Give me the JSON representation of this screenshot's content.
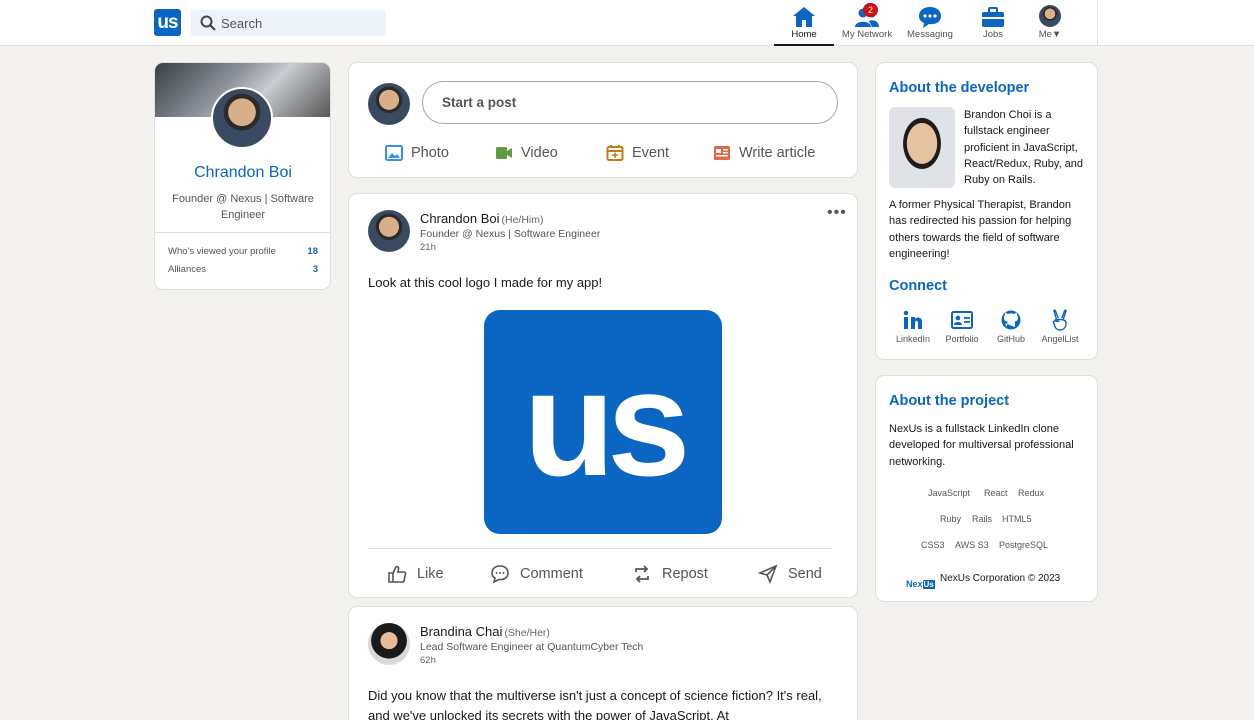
{
  "nav": {
    "logo_text": "us",
    "search_placeholder": "Search",
    "items": [
      {
        "label": "Home",
        "icon": "home-icon"
      },
      {
        "label": "My Network",
        "icon": "network-icon",
        "badge": "2"
      },
      {
        "label": "Messaging",
        "icon": "messaging-icon"
      },
      {
        "label": "Jobs",
        "icon": "jobs-icon"
      },
      {
        "label": "Me▼",
        "icon": "me-avatar"
      }
    ]
  },
  "profile": {
    "name": "Chrandon Boi",
    "headline": "Founder @ Nexus | Software Engineer",
    "stats": [
      {
        "label": "Who's viewed your profile",
        "value": "18"
      },
      {
        "label": "Alliances",
        "value": "3"
      }
    ]
  },
  "composer": {
    "placeholder": "Start a post",
    "actions": [
      {
        "label": "Photo",
        "color": "#378fe9"
      },
      {
        "label": "Video",
        "color": "#5f9b41"
      },
      {
        "label": "Event",
        "color": "#c37d16"
      },
      {
        "label": "Write article",
        "color": "#e06847"
      }
    ]
  },
  "posts": [
    {
      "author": "Chrandon Boi",
      "pronouns": "(He/Him)",
      "headline": "Founder @ Nexus | Software Engineer",
      "time": "21h",
      "text": "Look at this cool logo I made for my app!",
      "image_text": "us",
      "actions": [
        "Like",
        "Comment",
        "Repost",
        "Send"
      ]
    },
    {
      "author": "Brandina Chai",
      "pronouns": "(She/Her)",
      "headline": "Lead Software Engineer at QuantumCyber Tech",
      "time": "62h",
      "text": "Did you know that the multiverse isn't just a concept of science fiction? It's real, and we've unlocked its secrets with the power of JavaScript. At"
    }
  ],
  "about_dev": {
    "title": "About the developer",
    "bio1": "Brandon Choi is a fullstack engineer proficient in JavaScript, React/Redux, Ruby, and Ruby on Rails.",
    "bio2": "A former Physical Therapist, Brandon has redirected his passion for helping others towards the field of software engineering!",
    "connect_title": "Connect",
    "links": [
      {
        "label": "LinkedIn",
        "icon": "linkedin-icon"
      },
      {
        "label": "Portfolio",
        "icon": "portfolio-icon"
      },
      {
        "label": "GitHub",
        "icon": "github-icon"
      },
      {
        "label": "AngelList",
        "icon": "angellist-icon"
      }
    ]
  },
  "about_project": {
    "title": "About the project",
    "desc": "NexUs is a fullstack LinkedIn clone developed for multiversal professional networking.",
    "tags_row1": [
      "JavaScript",
      "React",
      "Redux"
    ],
    "tags_row2": [
      "Ruby",
      "Rails",
      "HTML5"
    ],
    "tags_row3": [
      "CSS3",
      "AWS S3",
      "PostgreSQL"
    ],
    "footer_logo_a": "Nex",
    "footer_logo_b": "Us",
    "footer": "NexUs Corporation © 2023"
  },
  "colors": {
    "brand": "#0a66c2",
    "background": "#f3f2ef",
    "badge": "#cc1016"
  }
}
